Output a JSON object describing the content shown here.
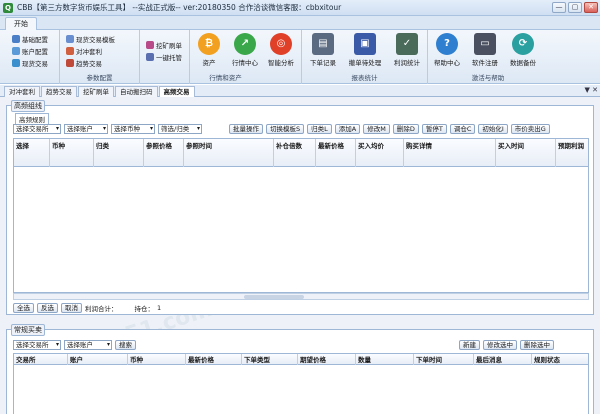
{
  "window": {
    "title": "CBB【第三方数字货币娱乐工具】 --实战正式版-- ver:20180350        合作洽谈微信客服：cbbxitour",
    "min": "—",
    "max": "▢",
    "close": "✕"
  },
  "ribbon": {
    "tab": "开始",
    "group1": {
      "items": [
        "基础配置",
        "账户配置",
        "现货交易"
      ],
      "label": ""
    },
    "group2": {
      "items": [
        "现货交易模板",
        "对冲套利",
        "趋势交易"
      ],
      "label": "参数配置"
    },
    "group3": {
      "items": [
        "挖矿刷单",
        "一键托管"
      ]
    },
    "group4": {
      "items": [
        "资产",
        "行情中心",
        "智能分析"
      ],
      "label": "行情和资产"
    },
    "group5": {
      "items": [
        "下单记录",
        "撤单待处理",
        "利润统计"
      ],
      "label": "报表统计"
    },
    "group6": {
      "items": [
        "帮助中心",
        "软件注册",
        "数据备份"
      ],
      "label": "激活与帮助"
    },
    "colors": {
      "bitcoin": "#f2a020",
      "market": "#3aa84a",
      "analysis": "#e04028",
      "help": "#2f7fd0"
    }
  },
  "doc_tabs": {
    "items": [
      "对冲套利",
      "趋势交易",
      "挖矿刷单",
      "自动搬扫码",
      "高频交易"
    ],
    "active_index": 4,
    "ctrl": "▼ ✕"
  },
  "hf_panel": {
    "group_label": "高频组线",
    "sub_tab": "高频规则",
    "toolbar": {
      "selects": [
        "选择交易所",
        "选择账户",
        "选择币种",
        "筛选/归类"
      ],
      "buttons": [
        "批量操作",
        "切换模板S",
        "归类L",
        "添加A",
        "修改M",
        "删除D",
        "暂停T",
        "调仓C",
        "初始化I",
        "市价卖出G"
      ]
    },
    "columns": [
      "选择",
      "币种",
      "归类",
      "参照价格",
      "参照时间",
      "补仓倍数",
      "最新价格",
      "买入均价",
      "购买详情",
      "买入时间",
      "预期利润"
    ],
    "footer": {
      "select_all": "全选",
      "invert": "反选",
      "cancel": "取消",
      "profit_label": "利润合计：",
      "position_label": "持仓：",
      "position_value": "1"
    }
  },
  "normal_panel": {
    "group_label": "常规买卖",
    "toolbar": {
      "selects": [
        "选择交易所",
        "选择账户"
      ],
      "search": "搜索",
      "buttons": [
        "新建",
        "修改选中",
        "删除选中"
      ]
    },
    "columns": [
      "交易所",
      "账户",
      "币种",
      "最新价格",
      "下单类型",
      "期望价格",
      "数量",
      "下单时间",
      "最后消息",
      "规则状态"
    ]
  },
  "watermark": "xue51.com"
}
